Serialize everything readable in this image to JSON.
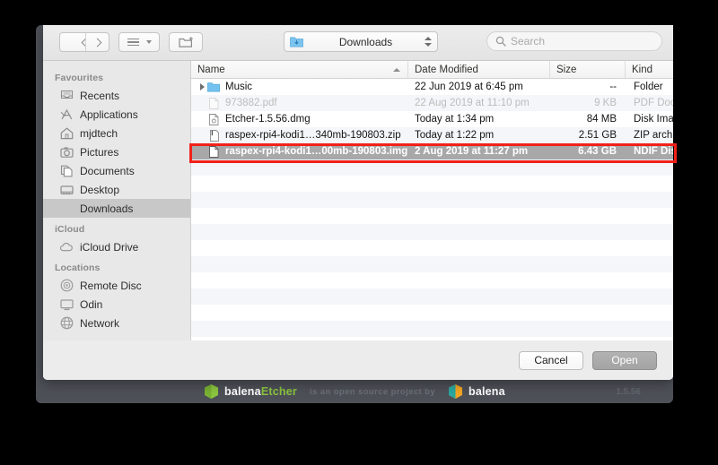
{
  "app": {
    "name": "balenaEtcher",
    "version": "1.5.56",
    "brand_prefix": "balena",
    "brand_suffix": "Etcher",
    "tagline": "is an open source project by",
    "parent_brand": "balena"
  },
  "toolbar": {
    "back_icon": "chevron-left-icon",
    "forward_icon": "chevron-right-icon",
    "view_icon": "list-view-icon",
    "new_folder_icon": "new-folder-icon",
    "path_label": "Downloads",
    "path_icon": "downloads-folder-icon",
    "stepper_icon": "up-down-stepper-icon",
    "search_placeholder": "Search",
    "search_value": "",
    "search_icon": "search-icon"
  },
  "sidebar": {
    "sections": [
      {
        "title": "Favourites",
        "items": [
          {
            "label": "Recents",
            "icon": "recents-icon",
            "selected": false
          },
          {
            "label": "Applications",
            "icon": "applications-icon",
            "selected": false
          },
          {
            "label": "mjdtech",
            "icon": "home-icon",
            "selected": false
          },
          {
            "label": "Pictures",
            "icon": "pictures-icon",
            "selected": false
          },
          {
            "label": "Documents",
            "icon": "documents-icon",
            "selected": false
          },
          {
            "label": "Desktop",
            "icon": "desktop-icon",
            "selected": false
          },
          {
            "label": "Downloads",
            "icon": "downloads-icon",
            "selected": true
          }
        ]
      },
      {
        "title": "iCloud",
        "items": [
          {
            "label": "iCloud Drive",
            "icon": "cloud-icon",
            "selected": false
          }
        ]
      },
      {
        "title": "Locations",
        "items": [
          {
            "label": "Remote Disc",
            "icon": "disc-icon",
            "selected": false
          },
          {
            "label": "Odin",
            "icon": "display-icon",
            "selected": false
          },
          {
            "label": "Network",
            "icon": "network-globe-icon",
            "selected": false
          }
        ]
      }
    ]
  },
  "filelist": {
    "columns": [
      {
        "key": "name",
        "label": "Name",
        "sorted": true,
        "sort_direction": "ascending"
      },
      {
        "key": "date",
        "label": "Date Modified",
        "sorted": false
      },
      {
        "key": "size",
        "label": "Size",
        "sorted": false
      },
      {
        "key": "kind",
        "label": "Kind",
        "sorted": false
      }
    ],
    "rows": [
      {
        "name": "Music",
        "date": "22 Jun 2019 at 6:45 pm",
        "size": "--",
        "kind": "Folder",
        "icon": "blue-folder-icon",
        "expandable": true,
        "state": "normal"
      },
      {
        "name": "973882.pdf",
        "date": "22 Aug 2019 at 11:10 pm",
        "size": "9 KB",
        "kind": "PDF Docu",
        "icon": "pdf-file-icon",
        "expandable": false,
        "state": "disabled"
      },
      {
        "name": "Etcher-1.5.56.dmg",
        "date": "Today at 1:34 pm",
        "size": "84 MB",
        "kind": "Disk Imag",
        "icon": "dmg-file-icon",
        "expandable": false,
        "state": "normal"
      },
      {
        "name": "raspex-rpi4-kodi1…340mb-190803.zip",
        "date": "Today at 1:22 pm",
        "size": "2.51 GB",
        "kind": "ZIP archiv",
        "icon": "zip-file-icon",
        "expandable": false,
        "state": "normal"
      },
      {
        "name": "raspex-rpi4-kodi1…00mb-190803.img",
        "date": "2 Aug 2019 at 11:27 pm",
        "size": "6.43 GB",
        "kind": "NDIF Dis",
        "icon": "img-file-icon",
        "expandable": false,
        "state": "selected"
      }
    ],
    "annotation": {
      "type": "red-highlight-rectangle",
      "color": "#f1211a",
      "target_row": 4
    }
  },
  "footer": {
    "cancel_label": "Cancel",
    "open_label": "Open"
  }
}
